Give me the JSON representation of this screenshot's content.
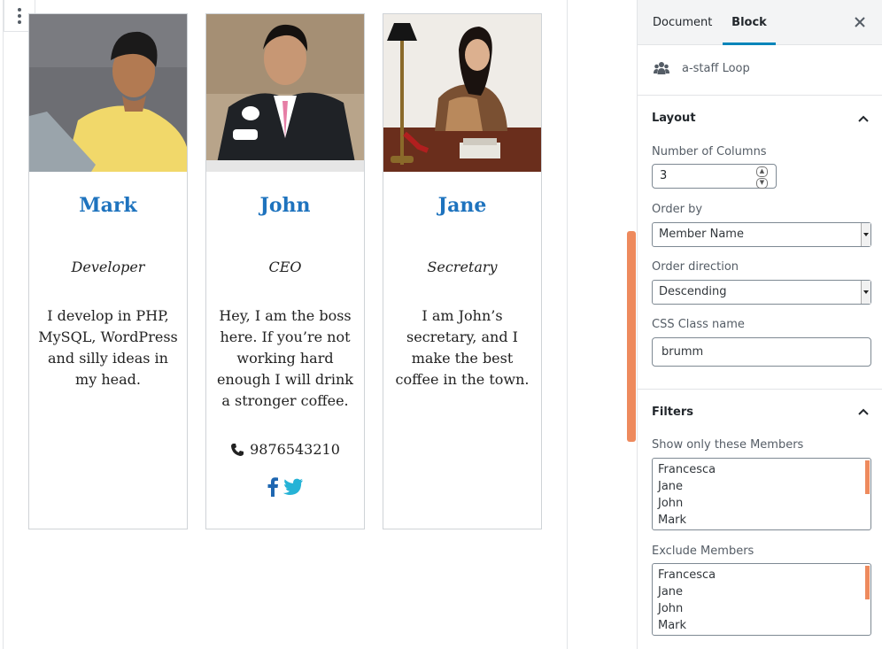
{
  "members": [
    {
      "name": "Mark",
      "role": "Developer",
      "bio": "I develop in PHP, MySQL, WordPress and silly ideas in my head."
    },
    {
      "name": "John",
      "role": "CEO",
      "bio": "Hey, I am the boss here. If you’re not working hard enough I will drink a stronger coffee.",
      "phone": "9876543210"
    },
    {
      "name": "Jane",
      "role": "Secretary",
      "bio": "I am John’s secretary, and I make the best coffee in the town."
    }
  ],
  "sidebar": {
    "tabs": {
      "document": "Document",
      "block": "Block"
    },
    "block_name": "a-staff Loop",
    "layout": {
      "title": "Layout",
      "columns_label": "Number of Columns",
      "columns_value": "3",
      "order_by_label": "Order by",
      "order_by_value": "Member Name",
      "order_dir_label": "Order direction",
      "order_dir_value": "Descending",
      "css_label": "CSS Class name",
      "css_value": "brumm"
    },
    "filters": {
      "title": "Filters",
      "show_label": "Show only these Members",
      "show_options": [
        "Francesca",
        "Jane",
        "John",
        "Mark"
      ],
      "exclude_label": "Exclude Members",
      "exclude_options": [
        "Francesca",
        "Jane",
        "John",
        "Mark"
      ]
    }
  },
  "colors": {
    "accent": "#0085ba",
    "name": "#1e73be",
    "scrollbar": "#ee8a5d"
  },
  "icons": [
    "more-vertical-icon",
    "phone-icon",
    "facebook-icon",
    "twitter-icon",
    "close-icon",
    "users-icon",
    "chevron-up-icon"
  ]
}
